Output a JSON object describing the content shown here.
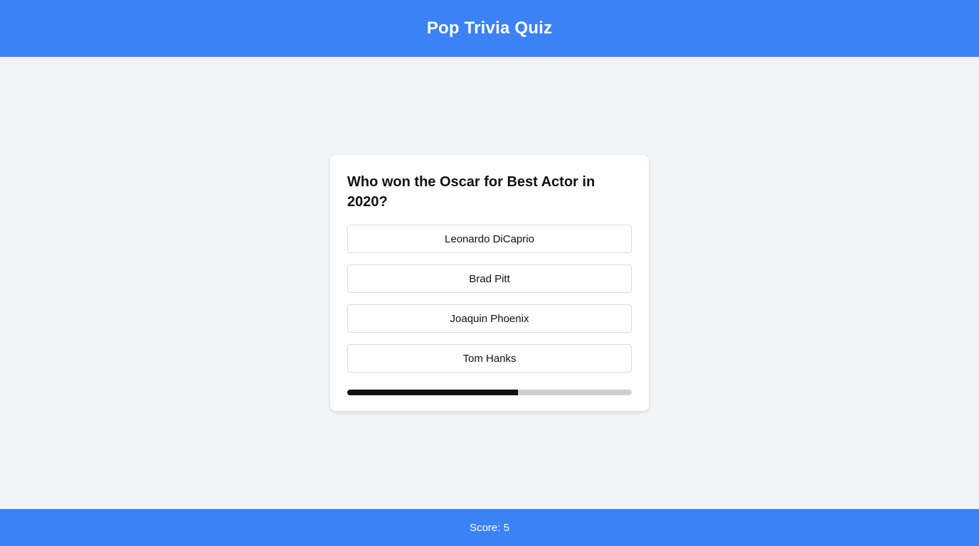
{
  "header": {
    "title": "Pop Trivia Quiz"
  },
  "quiz": {
    "question": "Who won the Oscar for Best Actor in 2020?",
    "answers": [
      {
        "label": "Leonardo DiCaprio"
      },
      {
        "label": "Brad Pitt"
      },
      {
        "label": "Joaquin Phoenix"
      },
      {
        "label": "Tom Hanks"
      }
    ],
    "progress": 0.6
  },
  "footer": {
    "score_text": "Score: 5"
  },
  "colors": {
    "accent": "#3b82f6",
    "background": "#f3f4f6",
    "progress_fill": "#111111",
    "progress_track": "#cfcfcf"
  }
}
